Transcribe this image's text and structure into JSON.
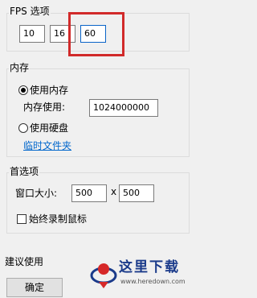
{
  "fps": {
    "group_title": "FPS 选项",
    "values": [
      "10",
      "16",
      "60"
    ]
  },
  "memory": {
    "group_title": "内存",
    "use_memory_label": "使用内存",
    "memory_usage_label": "内存使用:",
    "memory_usage_value": "1024000000",
    "use_disk_label": "使用硬盘",
    "temp_folder_link": "临时文件夹"
  },
  "preferences": {
    "group_title": "首选项",
    "window_size_label": "窗口大小:",
    "width_value": "500",
    "separator": "x",
    "height_value": "500",
    "always_record_mouse_label": "始终录制鼠标"
  },
  "footer": {
    "recommend_label": "建议使用",
    "ok_button": "确定"
  },
  "watermark": {
    "text": "这里下载",
    "url": "www.heredown.com"
  },
  "colors": {
    "highlight": "#d12a2a",
    "link": "#0066cc",
    "focused_border": "#0a64c8",
    "watermark_blue": "#1a3a8a",
    "watermark_red": "#d62828"
  }
}
